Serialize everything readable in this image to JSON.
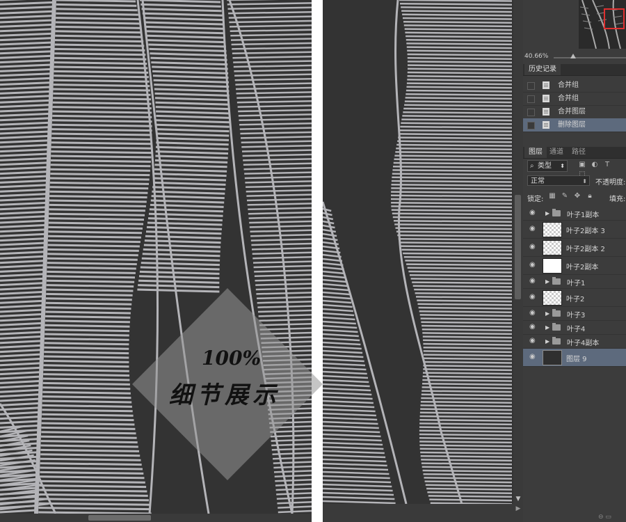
{
  "navigator": {
    "zoom": "40.66%"
  },
  "history": {
    "tab": "历史记录",
    "items": [
      {
        "label": "合并组",
        "selected": false
      },
      {
        "label": "合并组",
        "selected": false
      },
      {
        "label": "合并图层",
        "selected": false
      },
      {
        "label": "删除图层",
        "selected": true
      }
    ]
  },
  "layers_panel": {
    "tabs": [
      "图层",
      "通道",
      "路径"
    ],
    "kind_filter": "类型",
    "blend_mode": "正常",
    "opacity_label": "不透明度:",
    "lock_label": "锁定:",
    "fill_label": "填充:",
    "layers": [
      {
        "name": "叶子1副本",
        "type": "group",
        "selected": false
      },
      {
        "name": "叶子2副本 3",
        "type": "layer",
        "selected": false
      },
      {
        "name": "叶子2副本 2",
        "type": "layer",
        "selected": false
      },
      {
        "name": "叶子2副本",
        "type": "layer",
        "selected": false
      },
      {
        "name": "叶子1",
        "type": "group",
        "selected": false
      },
      {
        "name": "叶子2",
        "type": "layer",
        "selected": false
      },
      {
        "name": "叶子3",
        "type": "group",
        "selected": false
      },
      {
        "name": "叶子4",
        "type": "group",
        "selected": false
      },
      {
        "name": "叶子4副本",
        "type": "group",
        "selected": false
      },
      {
        "name": "图层 9",
        "type": "layer",
        "selected": true
      }
    ]
  },
  "watermark": {
    "line1": "100%",
    "line2": "细节展示"
  },
  "colors": {
    "canvas_bg": "#333333",
    "stripe": "#b4b4b8",
    "panel_bg": "#3c3c3c",
    "selected_row": "#5d6a7d"
  }
}
